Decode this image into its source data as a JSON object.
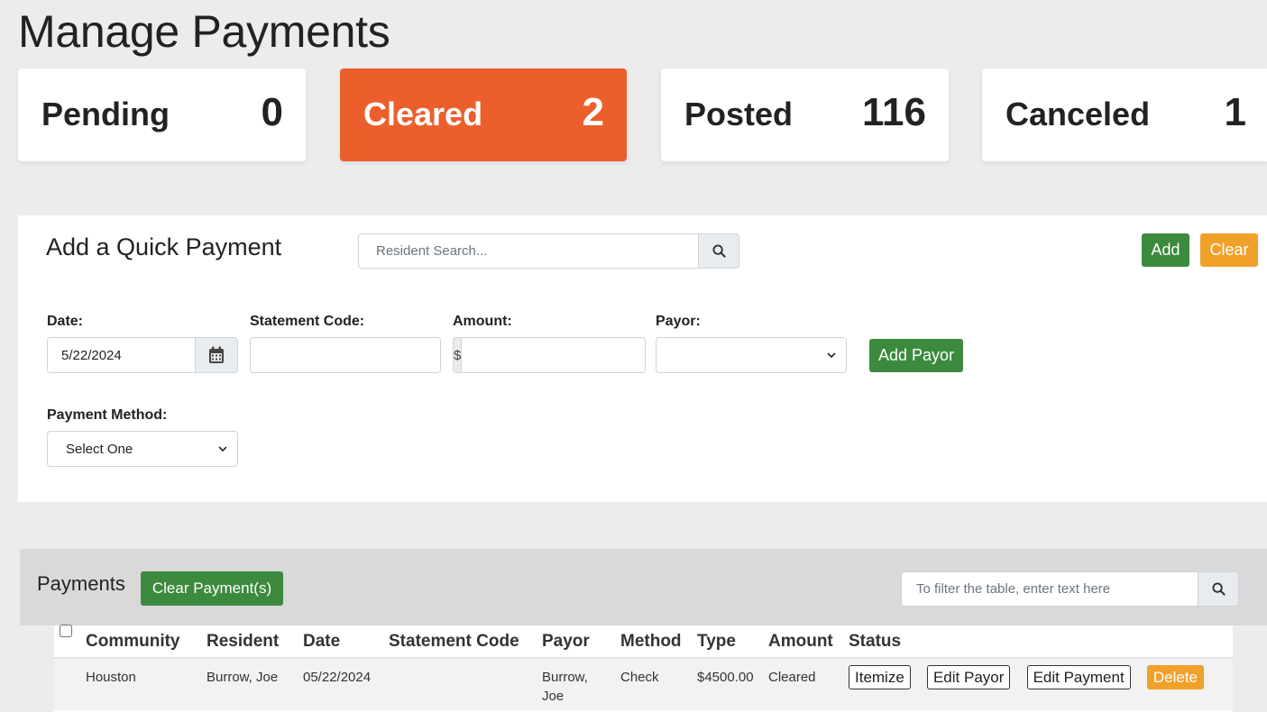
{
  "page": {
    "title": "Manage Payments"
  },
  "stats": [
    {
      "label": "Pending",
      "count": "0",
      "active": false
    },
    {
      "label": "Cleared",
      "count": "2",
      "active": true
    },
    {
      "label": "Posted",
      "count": "116",
      "active": false
    },
    {
      "label": "Canceled",
      "count": "1",
      "active": false
    }
  ],
  "quick_payment": {
    "title": "Add a Quick Payment",
    "resident_search_placeholder": "Resident Search...",
    "add_label": "Add",
    "clear_label": "Clear",
    "date_label": "Date:",
    "date_value": "5/22/2024",
    "statement_code_label": "Statement Code:",
    "statement_code_value": "",
    "amount_label": "Amount:",
    "amount_prefix": "$",
    "amount_value": "",
    "payor_label": "Payor:",
    "payor_selected": "",
    "add_payor_label": "Add Payor",
    "payment_method_label": "Payment Method:",
    "payment_method_selected": "Select One"
  },
  "payments": {
    "title": "Payments",
    "clear_payments_label": "Clear Payment(s)",
    "filter_placeholder": "To filter the table, enter text here",
    "columns": [
      "Community",
      "Resident",
      "Date",
      "Statement Code",
      "Payor",
      "Method",
      "Type",
      "Amount",
      "Status"
    ],
    "rows": [
      {
        "community": "Houston",
        "resident": "Burrow, Joe",
        "date": "05/22/2024",
        "statement_code": "",
        "payor_line1": "Burrow,",
        "payor_line2": "Joe",
        "method": "Check",
        "type": "$4500.00",
        "amount": "Cleared",
        "actions": [
          "Itemize",
          "Edit Payor",
          "Edit Payment",
          "Delete"
        ]
      }
    ]
  },
  "colors": {
    "accent_orange": "#eb5f2c",
    "button_green": "#3c8a3e",
    "button_amber": "#f0a129"
  }
}
